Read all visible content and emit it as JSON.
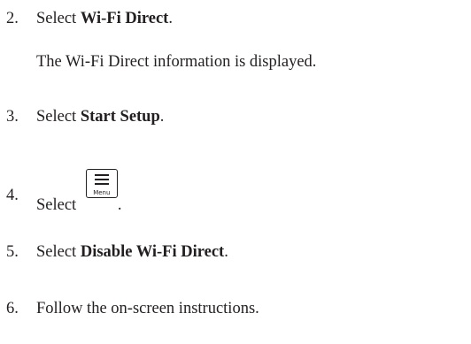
{
  "steps": [
    {
      "number": "2.",
      "text_before": "Select ",
      "bold": "Wi-Fi Direct",
      "text_after": "."
    },
    {
      "note": "The Wi-Fi Direct information is displayed."
    },
    {
      "number": "3.",
      "text_before": "Select ",
      "bold": "Start Setup",
      "text_after": "."
    },
    {
      "number": "4.",
      "text_before": "Select ",
      "icon": "menu-icon",
      "icon_label": "Menu",
      "text_after": "."
    },
    {
      "number": "5.",
      "text_before": "Select ",
      "bold": "Disable Wi-Fi Direct",
      "text_after": "."
    },
    {
      "number": "6.",
      "text_before": "Follow the on-screen instructions."
    }
  ]
}
